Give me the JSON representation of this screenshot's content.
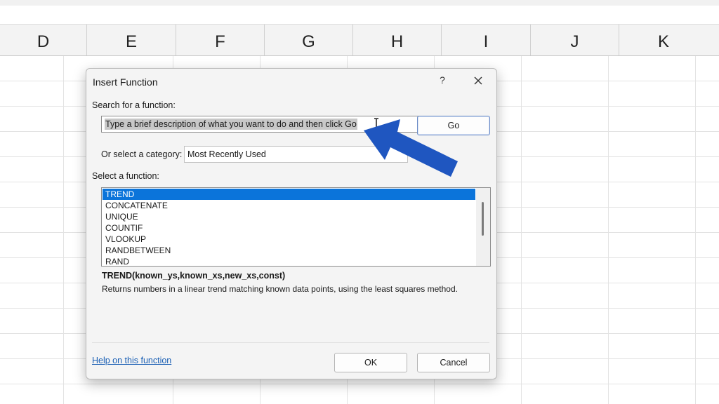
{
  "spreadsheet": {
    "columns": [
      "D",
      "E",
      "F",
      "G",
      "H",
      "I",
      "J",
      "K"
    ]
  },
  "dialog": {
    "title": "Insert Function",
    "help_symbol": "?",
    "close_icon": "close-icon",
    "search": {
      "label": "Search for a function:",
      "value": "Type a brief description of what you want to do and then click Go",
      "go_label": "Go"
    },
    "category": {
      "label": "Or select a category:",
      "value": "Most Recently Used"
    },
    "functions": {
      "label": "Select a function:",
      "items": [
        "TREND",
        "CONCATENATE",
        "UNIQUE",
        "COUNTIF",
        "VLOOKUP",
        "RANDBETWEEN",
        "RAND"
      ],
      "selected": "TREND"
    },
    "syntax": "TREND(known_ys,known_xs,new_xs,const)",
    "description": "Returns numbers in a linear trend matching known data points, using the least squares method.",
    "help_link": "Help on this function",
    "ok_label": "OK",
    "cancel_label": "Cancel"
  },
  "annotation": {
    "arrow_icon": "pointer-arrow-icon",
    "arrow_color": "#1f56c0"
  },
  "colors": {
    "selection": "#0b74da",
    "link": "#1a5fb4"
  }
}
